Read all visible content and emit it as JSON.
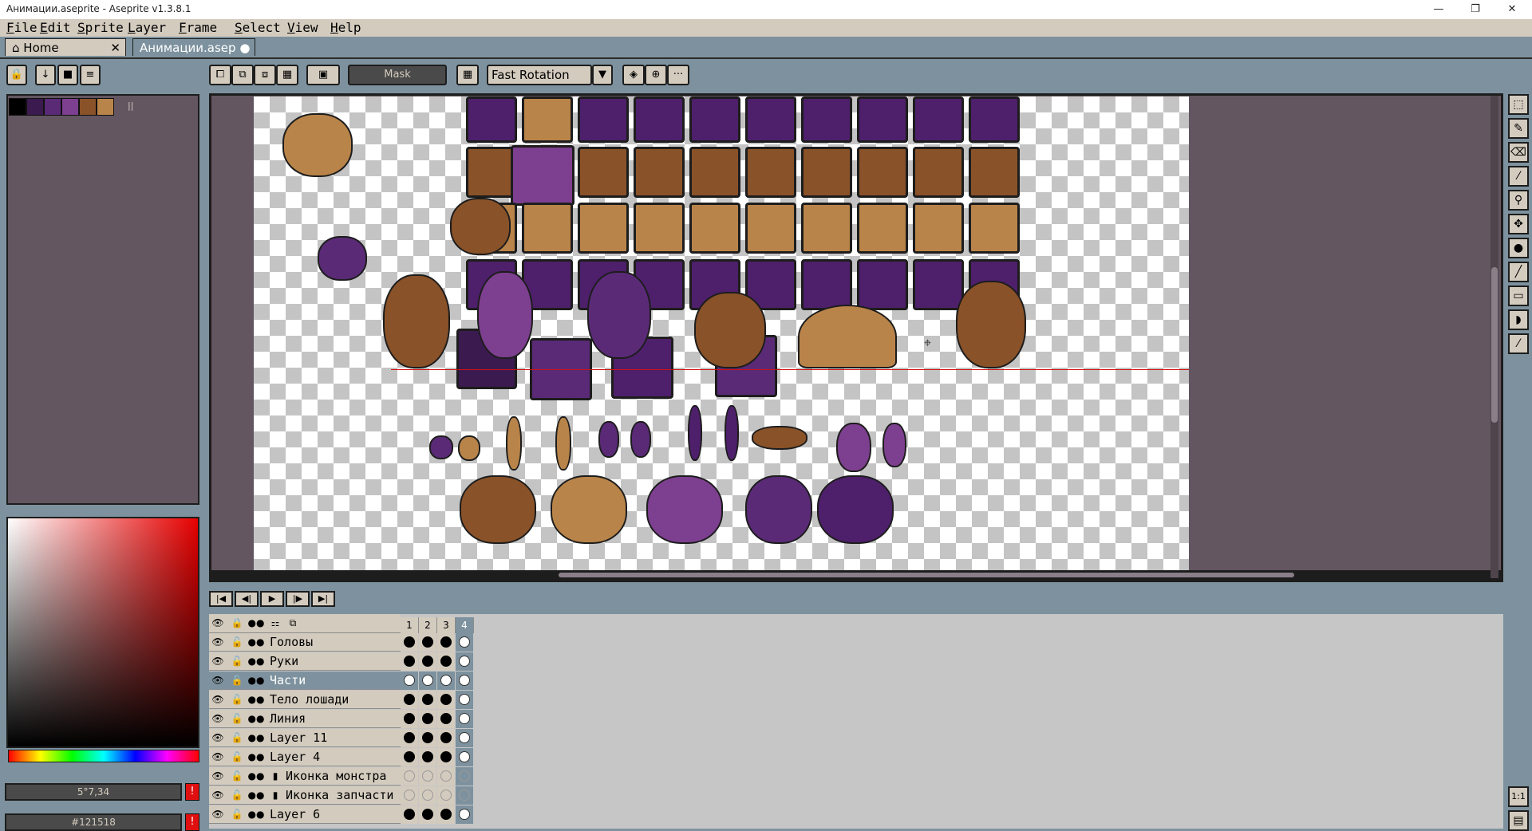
{
  "window": {
    "title": "Анимации.aseprite - Aseprite v1.3.8.1",
    "min": "—",
    "max": "❐",
    "close": "✕"
  },
  "menu": [
    "File",
    "Edit",
    "Sprite",
    "Layer",
    "Frame",
    "Select",
    "View",
    "Help"
  ],
  "tabs": [
    {
      "label": "Home",
      "close": "✕"
    },
    {
      "label": "Анимации.asep",
      "modified": "●"
    }
  ],
  "toolbar": {
    "mask_label": "Mask",
    "rotation_algorithm": "Fast Rotation",
    "more": "···"
  },
  "palette": {
    "colors": [
      "#000000",
      "#3b1a4f",
      "#5a2a77",
      "#7d3f8f",
      "#8a5228",
      "#b98449"
    ]
  },
  "colors": {
    "foreground": "5°7,34",
    "background": "#121518",
    "accent": "#e01010"
  },
  "timeline": {
    "nav": [
      "|◀",
      "◀|",
      "▶",
      "|▶",
      "▶|"
    ],
    "frames": [
      "1",
      "2",
      "3",
      "4"
    ],
    "layers": [
      {
        "name": "Головы",
        "type": "layer",
        "selected": false,
        "cels": [
          "filled",
          "filled",
          "filled",
          "empty"
        ]
      },
      {
        "name": "Руки",
        "type": "layer",
        "selected": false,
        "cels": [
          "filled",
          "filled",
          "filled",
          "empty"
        ]
      },
      {
        "name": "Части",
        "type": "layer",
        "selected": true,
        "cels": [
          "empty",
          "empty",
          "empty",
          "empty"
        ]
      },
      {
        "name": "Тело лошади",
        "type": "layer",
        "selected": false,
        "cels": [
          "filled",
          "filled",
          "filled",
          "empty"
        ]
      },
      {
        "name": "Линия",
        "type": "layer",
        "selected": false,
        "cels": [
          "filled",
          "filled",
          "filled",
          "empty"
        ]
      },
      {
        "name": "Layer 11",
        "type": "layer",
        "selected": false,
        "cels": [
          "filled",
          "filled",
          "filled",
          "empty"
        ]
      },
      {
        "name": "Layer 4",
        "type": "layer",
        "selected": false,
        "cels": [
          "filled",
          "filled",
          "filled",
          "empty"
        ]
      },
      {
        "name": "Иконка монстра",
        "type": "group",
        "selected": false,
        "cels": [
          "faded",
          "faded",
          "faded",
          "faded"
        ]
      },
      {
        "name": "Иконка запчасти",
        "type": "group",
        "selected": false,
        "cels": [
          "faded",
          "faded",
          "faded",
          "faded"
        ]
      },
      {
        "name": "Layer 6",
        "type": "layer",
        "selected": false,
        "cels": [
          "filled",
          "filled",
          "filled",
          "empty"
        ]
      }
    ]
  },
  "right_tools": [
    "marquee-tool",
    "pencil-tool",
    "eraser-tool",
    "eyedropper-tool",
    "zoom-tool",
    "move-tool",
    "fill-tool",
    "line-tool",
    "rectangle-tool",
    "contour-tool",
    "blur-tool"
  ],
  "zoom_button": "1:1"
}
